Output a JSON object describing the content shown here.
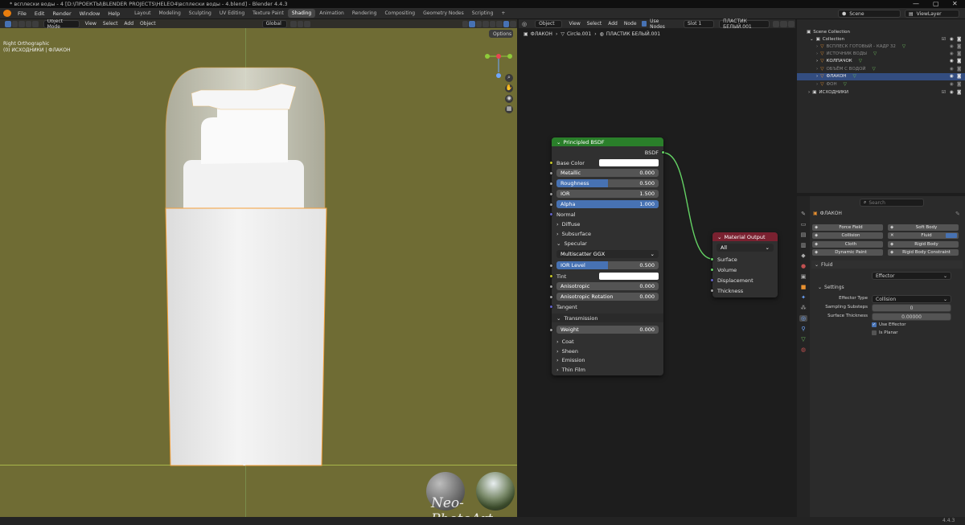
{
  "window": {
    "title": "* всплески воды - 4 [D:\\ПРОЕКТЫ\\BLENDER PROJECTS\\HELEO4\\всплески воды - 4.blend] - Blender 4.4.3",
    "minimize": "—",
    "maximize": "▢",
    "close": "✕"
  },
  "menu": {
    "file": "File",
    "edit": "Edit",
    "render": "Render",
    "window": "Window",
    "help": "Help"
  },
  "workspaces": [
    "Layout",
    "Modeling",
    "Sculpting",
    "UV Editing",
    "Texture Paint",
    "Shading",
    "Animation",
    "Rendering",
    "Compositing",
    "Geometry Nodes",
    "Scripting"
  ],
  "workspace_add": "+",
  "active_workspace": "Shading",
  "scene": {
    "label": "Scene",
    "view_layer": "ViewLayer"
  },
  "viewport": {
    "mode": "Object Mode",
    "menu": [
      "View",
      "Select",
      "Add",
      "Object"
    ],
    "transform": "Global",
    "options": "Options",
    "view_name": "Right Orthographic",
    "collection_path": "(0) ИСХОДНИКИ | ФЛАКОН",
    "hdri_sphere_label": "HDRI preview"
  },
  "watermark": "Neo-PhotoArt",
  "node_editor": {
    "object": "Object",
    "menu": [
      "View",
      "Select",
      "Add",
      "Node"
    ],
    "use_nodes": "Use Nodes",
    "slot": "Slot 1",
    "material": "ПЛАСТИК БЕЛЫЙ.001",
    "breadcrumb": [
      "ФЛАКОН",
      "Circle.001",
      "ПЛАСТИК БЕЛЫЙ.001"
    ],
    "principled": {
      "title": "Principled BSDF",
      "output": "BSDF",
      "base_color": "Base Color",
      "metallic": {
        "label": "Metallic",
        "value": "0.000",
        "fill": 0
      },
      "roughness": {
        "label": "Roughness",
        "value": "0.500",
        "fill": 0.5
      },
      "ior": {
        "label": "IOR",
        "value": "1.500",
        "fill": 0
      },
      "alpha": {
        "label": "Alpha",
        "value": "1.000",
        "fill": 1
      },
      "normal": "Normal",
      "diffuse": "Diffuse",
      "subsurface": "Subsurface",
      "specular": "Specular",
      "distribution": "Multiscatter GGX",
      "ior_level": {
        "label": "IOR Level",
        "value": "0.500",
        "fill": 0.5
      },
      "tint": "Tint",
      "anisotropic": {
        "label": "Anisotropic",
        "value": "0.000",
        "fill": 0
      },
      "anisotropic_rotation": {
        "label": "Anisotropic Rotation",
        "value": "0.000",
        "fill": 0
      },
      "tangent": "Tangent",
      "transmission": "Transmission",
      "weight": {
        "label": "Weight",
        "value": "0.000",
        "fill": 0
      },
      "coat": "Coat",
      "sheen": "Sheen",
      "emission": "Emission",
      "thin_film": "Thin Film"
    },
    "output_node": {
      "title": "Material Output",
      "target": "All",
      "surface": "Surface",
      "volume": "Volume",
      "displacement": "Displacement",
      "thickness": "Thickness"
    }
  },
  "outliner": {
    "scene_collection": "Scene Collection",
    "collection": "Collection",
    "items": [
      {
        "name": "ВСПЛЕСК ГОТОВЫЙ - КАДР 32",
        "dim": true
      },
      {
        "name": "ИСТОЧНИК ВОДЫ",
        "dim": true
      },
      {
        "name": "КОЛПАЧОК",
        "dim": false
      },
      {
        "name": "ОБЪЁМ С ВОДОЙ",
        "dim": true
      },
      {
        "name": "ФЛАКОН",
        "dim": false,
        "selected": true
      },
      {
        "name": "ФОН",
        "dim": true
      }
    ],
    "sources": "ИСХОДНИКИ"
  },
  "properties": {
    "search_placeholder": "Search",
    "object_name": "ФЛАКОН",
    "physics_buttons": [
      {
        "label": "Force Field",
        "x": 0
      },
      {
        "label": "Soft Body",
        "x": 1
      },
      {
        "label": "Collision",
        "x": 0
      },
      {
        "label": "Fluid",
        "x": 1
      },
      {
        "label": "Cloth",
        "x": 0
      },
      {
        "label": "Rigid Body",
        "x": 1
      },
      {
        "label": "Dynamic Paint",
        "x": 0
      },
      {
        "label": "Rigid Body Constraint",
        "x": 1
      }
    ],
    "fluid_panel": "Fluid",
    "type_label": "Type",
    "type_value": "Effector",
    "settings_panel": "Settings",
    "effector_type_label": "Effector Type",
    "effector_type_value": "Collision",
    "sampling_substeps_label": "Sampling Substeps",
    "sampling_substeps_value": "0",
    "surface_thickness_label": "Surface Thickness",
    "surface_thickness_value": "0.00000",
    "use_effector": "Use Effector",
    "is_planar": "Is Planar"
  },
  "status": {
    "version": "4.4.3"
  },
  "colors": {
    "accent": "#4772b3",
    "node_green_header": "#2a7f2a",
    "node_red_header": "#7a2130",
    "viewport_bg": "#6f6c34",
    "selection": "#f5a03a"
  }
}
